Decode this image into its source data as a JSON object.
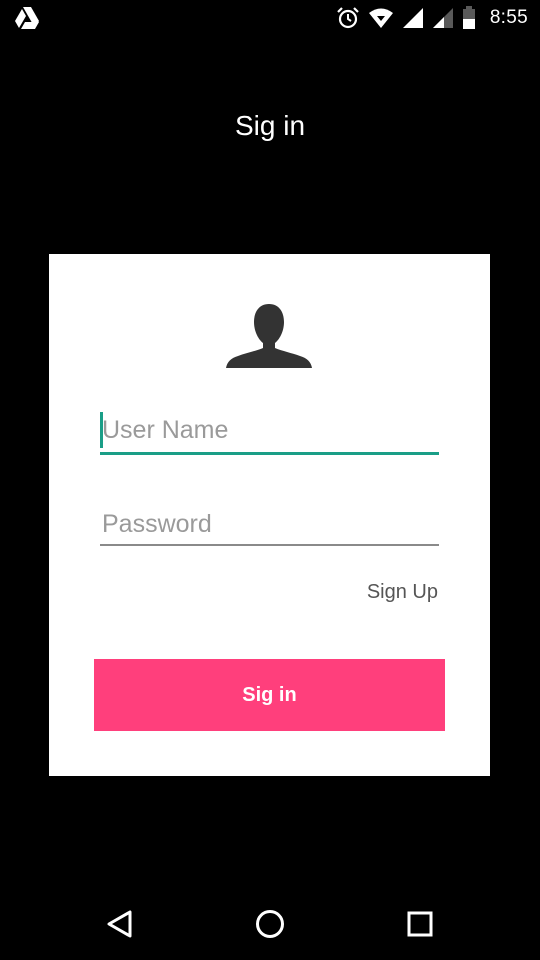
{
  "status_bar": {
    "time": "8:55",
    "icons": [
      "drive-icon",
      "alarm-icon",
      "wifi-icon",
      "signal-icon",
      "signal-secondary-icon",
      "battery-icon"
    ]
  },
  "header": {
    "title": "Sig in"
  },
  "form": {
    "avatar_icon": "person-silhouette-icon",
    "username": {
      "value": "",
      "placeholder": "User Name"
    },
    "password": {
      "value": "",
      "placeholder": "Password"
    },
    "signup_label": "Sign Up",
    "signin_label": "Sig in"
  },
  "nav_bar": {
    "icons": [
      "back-icon",
      "home-icon",
      "recents-icon"
    ]
  },
  "colors": {
    "background": "#000000",
    "card": "#ffffff",
    "accent": "#1a9e87",
    "button": "#ff3f7c"
  }
}
